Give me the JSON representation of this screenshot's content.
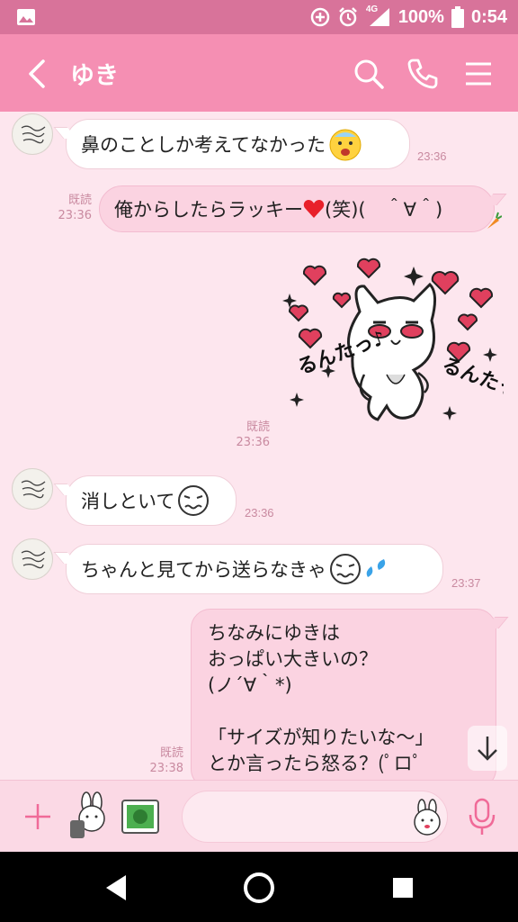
{
  "status_bar": {
    "network": "4G",
    "battery": "100%",
    "time": "0:54",
    "icons": [
      "image-icon",
      "data-saver-icon",
      "alarm-icon",
      "signal-icon",
      "battery-icon"
    ]
  },
  "header": {
    "title": "ゆき",
    "icons": [
      "back-icon",
      "search-icon",
      "phone-icon",
      "menu-icon"
    ]
  },
  "messages": [
    {
      "direction": "in",
      "text": "鼻のことしか考えてなかった",
      "emoji": "sweat-face-emoji",
      "time": "23:36"
    },
    {
      "direction": "out",
      "text": "俺からしたらラッキー",
      "text_after": "(笑)(　＾∀＾)",
      "emoji": "heart-emoji",
      "read": "既読",
      "time": "23:36"
    },
    {
      "direction": "out",
      "type": "sticker",
      "sticker": "cat-hearts-sticker",
      "sticker_text": [
        "るんたっ♪",
        "るんたっ♪"
      ],
      "read": "既読",
      "time": "23:36"
    },
    {
      "direction": "in",
      "text": "消しといて",
      "emoji": "worried-face-emoji",
      "time": "23:36"
    },
    {
      "direction": "in",
      "text": "ちゃんと見てから送らなきゃ",
      "emoji": "worried-face-emoji",
      "time": "23:37"
    },
    {
      "direction": "out",
      "lines": [
        "ちなみにゆきは",
        "おっぱい大きいの？",
        "(ノ´∀｀*)",
        "",
        "「サイズが知りたいな〜」",
        "とか言ったら怒る？(ﾟロﾟ"
      ],
      "read": "既読",
      "time": "23:38"
    }
  ],
  "input_bar": {
    "placeholder": "",
    "icons": [
      "plus-icon",
      "sticker-icon",
      "photo-icon",
      "emoji-sticker-icon",
      "mic-icon"
    ]
  },
  "nav_bar": {
    "icons": [
      "back-triangle-icon",
      "home-circle-icon",
      "recent-square-icon"
    ]
  },
  "colors": {
    "status_bar": "#d8739a",
    "header": "#f58fb3",
    "chat_bg": "#fde6ee",
    "bubble_out": "#fbd3e1",
    "bubble_in": "#ffffff",
    "time_text": "#c98aa0"
  }
}
